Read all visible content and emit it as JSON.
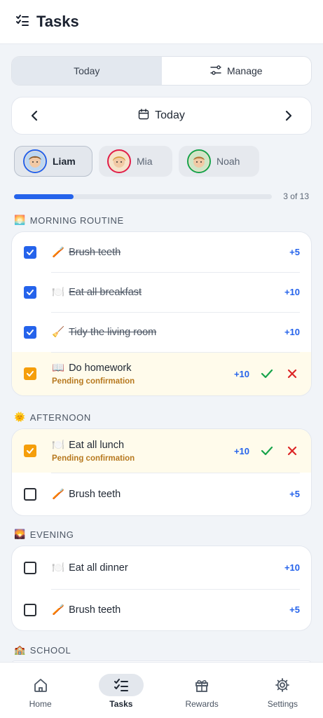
{
  "header": {
    "title": "Tasks",
    "icon": "checklist-icon"
  },
  "view_toggle": {
    "today_label": "Today",
    "manage_label": "Manage"
  },
  "date_nav": {
    "label": "Today"
  },
  "children": [
    {
      "name": "Liam",
      "ring_color": "#2563eb"
    },
    {
      "name": "Mia",
      "ring_color": "#e11d48"
    },
    {
      "name": "Noah",
      "ring_color": "#16a34a"
    }
  ],
  "progress": {
    "done": 3,
    "total": 13,
    "label": "3 of 13"
  },
  "sections": {
    "morning": {
      "title": "MORNING ROUTINE",
      "emoji": "🌅",
      "tasks": [
        {
          "emoji": "🪥",
          "label": "Brush teeth",
          "points": "+5",
          "state": "done"
        },
        {
          "emoji": "🍽️",
          "label": "Eat all breakfast",
          "points": "+10",
          "state": "done"
        },
        {
          "emoji": "🧹",
          "label": "Tidy the living room",
          "points": "+10",
          "state": "done"
        },
        {
          "emoji": "📖",
          "label": "Do homework",
          "points": "+10",
          "state": "pending",
          "pending_label": "Pending confirmation"
        }
      ]
    },
    "afternoon": {
      "title": "AFTERNOON",
      "emoji": "🌞",
      "tasks": [
        {
          "emoji": "🍽️",
          "label": "Eat all lunch",
          "points": "+10",
          "state": "pending",
          "pending_label": "Pending confirmation"
        },
        {
          "emoji": "🪥",
          "label": "Brush teeth",
          "points": "+5",
          "state": "todo"
        }
      ]
    },
    "evening": {
      "title": "EVENING",
      "emoji": "🌄",
      "tasks": [
        {
          "emoji": "🍽️",
          "label": "Eat all dinner",
          "points": "+10",
          "state": "todo"
        },
        {
          "emoji": "🪥",
          "label": "Brush teeth",
          "points": "+5",
          "state": "todo"
        }
      ]
    },
    "school": {
      "title": "SCHOOL",
      "emoji": "🏫"
    }
  },
  "tabbar": {
    "home": "Home",
    "tasks": "Tasks",
    "rewards": "Rewards",
    "settings": "Settings"
  },
  "colors": {
    "accent": "#2563eb",
    "pending_bg": "#fffbeb",
    "approve": "#16a34a",
    "reject": "#dc2626",
    "pending_check": "#f59e0b"
  }
}
